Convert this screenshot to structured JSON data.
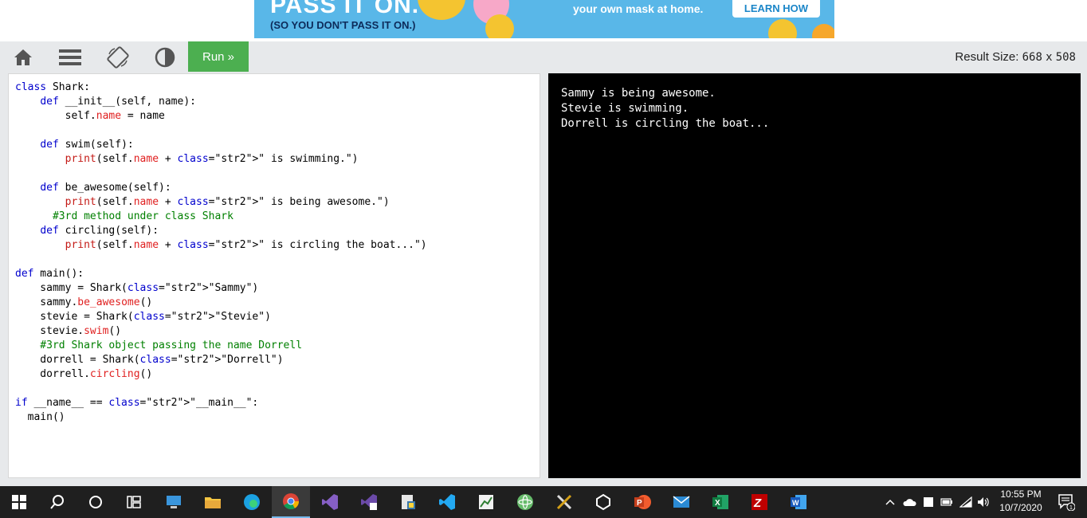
{
  "ad": {
    "headline": "PASS IT ON.",
    "subline": "(SO YOU DON'T PASS IT ON.)",
    "middle_text": "your own mask at home.",
    "cta_label": "LEARN HOW"
  },
  "toolbar": {
    "icons": [
      "home-icon",
      "menu-icon",
      "rotate-icon",
      "contrast-icon"
    ],
    "run_label": "Run »",
    "result_size_label": "Result Size:",
    "result_width": "668",
    "result_x": "x",
    "result_height": "508"
  },
  "editor": {
    "lines": [
      "class Shark:",
      "    def __init__(self, name):",
      "        self.name = name",
      "",
      "    def swim(self):",
      "        print(self.name + \" is swimming.\")",
      "",
      "    def be_awesome(self):",
      "        print(self.name + \" is being awesome.\")",
      "      #3rd method under class Shark",
      "    def circling(self):",
      "        print(self.name + \" is circling the boat...\")",
      "",
      "def main():",
      "    sammy = Shark(\"Sammy\")",
      "    sammy.be_awesome()",
      "    stevie = Shark(\"Stevie\")",
      "    stevie.swim()",
      "    #3rd Shark object passing the name Dorrell",
      "    dorrell = Shark(\"Dorrell\")",
      "    dorrell.circling()",
      "",
      "if __name__ == \"__main__\":",
      "  main()"
    ]
  },
  "output": {
    "lines": [
      "Sammy is being awesome.",
      "Stevie is swimming.",
      "Dorrell is circling the boat..."
    ]
  },
  "taskbar": {
    "apps": [
      "windows-start-icon",
      "search-icon",
      "cortana-icon",
      "task-view-icon",
      "remote-desktop-icon",
      "file-explorer-icon",
      "edge-icon",
      "chrome-icon",
      "visual-studio-icon",
      "visual-studio-blend-icon",
      "python-installer-icon",
      "vscode-icon",
      "chart-app-icon",
      "atom-icon",
      "tools-icon",
      "unity-icon",
      "powerpoint-icon",
      "mail-icon",
      "excel-icon",
      "filezilla-icon",
      "word-icon"
    ],
    "active_app": "chrome-icon",
    "time": "10:55 PM",
    "date": "10/7/2020",
    "notification_count": "1"
  }
}
